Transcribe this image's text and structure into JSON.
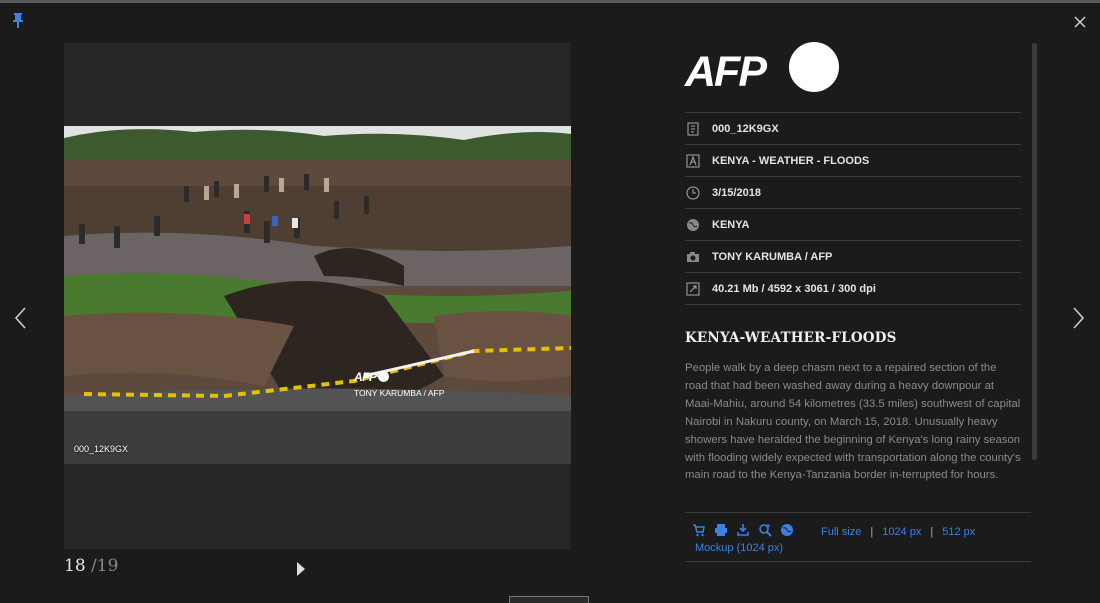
{
  "viewer": {
    "current": "18",
    "total": "/19"
  },
  "photo": {
    "id_overlay": "000_12K9GX",
    "watermark_logo": "AFP",
    "watermark_credit": "TONY KARUMBA / AFP"
  },
  "brand": {
    "logo_text": "AFP"
  },
  "meta": [
    {
      "icon": "id-icon",
      "value": "000_12K9GX"
    },
    {
      "icon": "title-icon",
      "value": "KENYA - WEATHER - FLOODS"
    },
    {
      "icon": "clock-icon",
      "value": "3/15/2018"
    },
    {
      "icon": "globe-icon",
      "value": "KENYA"
    },
    {
      "icon": "camera-icon",
      "value": "TONY KARUMBA / AFP"
    },
    {
      "icon": "resize-icon",
      "value": "40.21 Mb / 4592 x 3061 / 300 dpi"
    }
  ],
  "headline": "KENYA-WEATHER-FLOODS",
  "caption": "People walk by a deep chasm next to a repaired section of the road that had been washed away during a heavy downpour at Maai-Mahiu, around 54 kilometres (33.5 miles) southwest of capital Nairobi in Nakuru county, on March 15, 2018. Unusually heavy showers have heralded the beginning of Kenya's long rainy season with flooding widely expected with transportation along the county's main road to the Kenya-Tanzania border in-terrupted for hours.",
  "actions": {
    "full_size": "Full size",
    "sep": "|",
    "px1024": "1024 px",
    "px512": "512 px",
    "mockup": "Mockup (1024 px)"
  },
  "colors": {
    "link": "#3b82e0",
    "background": "#1b1b1b"
  }
}
